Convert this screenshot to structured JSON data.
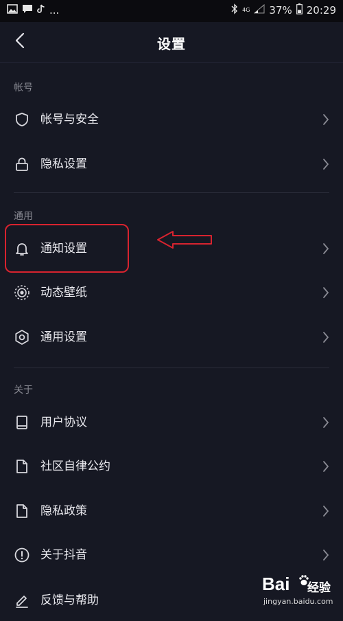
{
  "status_bar": {
    "battery": "37%",
    "time": "20:29",
    "network": "4G",
    "overflow": "..."
  },
  "nav": {
    "title": "设置",
    "back_icon": "chevron-left-icon"
  },
  "sections": {
    "account": {
      "header": "帐号",
      "items": [
        {
          "label": "帐号与安全",
          "icon": "shield-icon"
        },
        {
          "label": "隐私设置",
          "icon": "lock-icon"
        }
      ]
    },
    "general": {
      "header": "通用",
      "items": [
        {
          "label": "通知设置",
          "icon": "bell-icon"
        },
        {
          "label": "动态壁纸",
          "icon": "live-wallpaper-icon"
        },
        {
          "label": "通用设置",
          "icon": "gear-icon"
        }
      ]
    },
    "about": {
      "header": "关于",
      "items": [
        {
          "label": "用户协议",
          "icon": "book-icon"
        },
        {
          "label": "社区自律公约",
          "icon": "document-icon"
        },
        {
          "label": "隐私政策",
          "icon": "document-icon"
        },
        {
          "label": "关于抖音",
          "icon": "info-exclamation-icon"
        },
        {
          "label": "反馈与帮助",
          "icon": "edit-pen-icon"
        }
      ]
    }
  },
  "annotation": {
    "highlight_color": "#d8232f"
  },
  "watermark": {
    "brand": "Bai",
    "sub": "经验",
    "url": "jingyan.baidu.com"
  },
  "colors": {
    "background": "#161823",
    "text": "#e9e9ee",
    "section_header": "#8a8b94",
    "divider": "#2a2c3a"
  }
}
